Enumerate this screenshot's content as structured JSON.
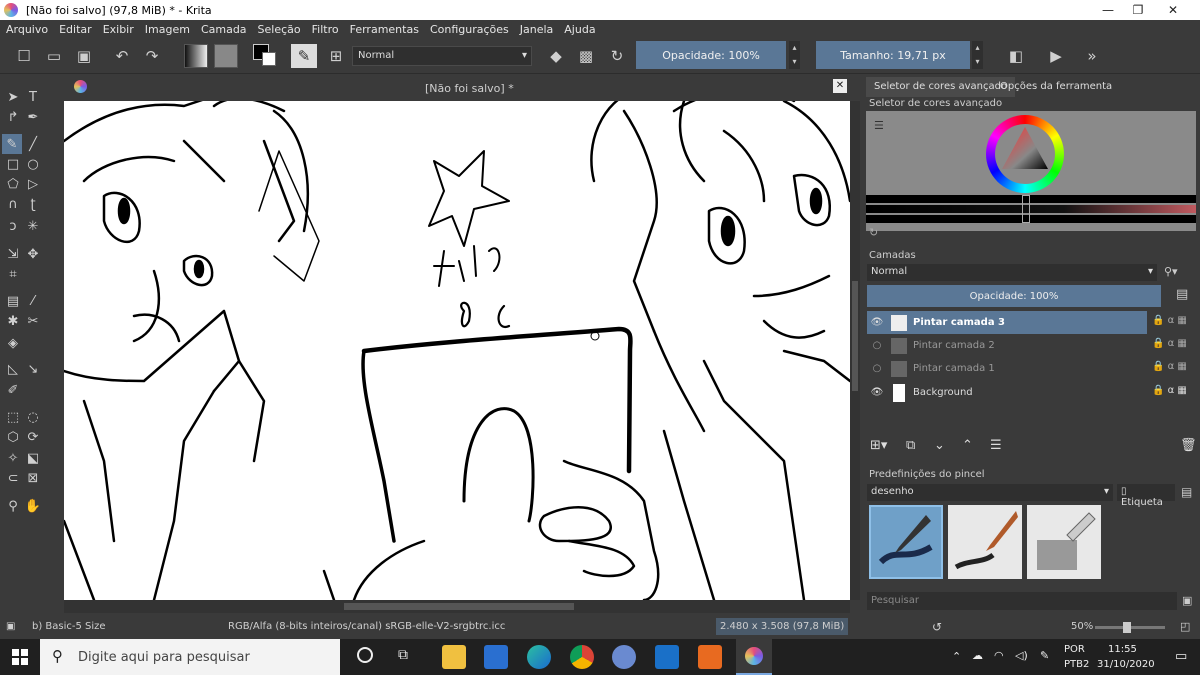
{
  "window": {
    "title": "[Não foi salvo]  (97,8 MiB)  * - Krita",
    "minimize": "—",
    "maximize": "❐",
    "close": "✕"
  },
  "menu": [
    "Arquivo",
    "Editar",
    "Exibir",
    "Imagem",
    "Camada",
    "Seleção",
    "Filtro",
    "Ferramentas",
    "Configurações",
    "Janela",
    "Ajuda"
  ],
  "toolbar": {
    "blend_mode": "Normal",
    "opacity": "Opacidade: 100%",
    "size": "Tamanho: 19,71 px"
  },
  "canvas": {
    "document_tab": "[Não foi salvo]  *",
    "close_tab": "✕"
  },
  "dock": {
    "tab_color": "Seletor de cores avançado",
    "tab_tool": "Opções da ferramenta",
    "color_panel_title": "Seletor de cores avançado",
    "layers_title": "Camadas",
    "layer_blend": "Normal",
    "layer_opacity": "Opacidade:  100%",
    "layers": [
      {
        "name": "Pintar camada 3",
        "active": true,
        "visible": true
      },
      {
        "name": "Pintar camada 2",
        "active": false,
        "visible": false
      },
      {
        "name": "Pintar camada 1",
        "active": false,
        "visible": false
      },
      {
        "name": "Background",
        "active": false,
        "visible": true
      }
    ],
    "presets_title": "Predefinições do pincel",
    "preset_group": "desenho",
    "tag_label": "Etiqueta",
    "search_placeholder": "Pesquisar"
  },
  "status": {
    "brush": "b) Basic-5 Size",
    "color_info": "RGB/Alfa (8-bits inteiros/canal)  sRGB-elle-V2-srgbtrc.icc",
    "dimensions": "2.480 x 3.508 (97,8 MiB)",
    "zoom": "50%"
  },
  "taskbar": {
    "search_placeholder": "Digite aqui para pesquisar",
    "language": "POR",
    "layout": "PTB2",
    "time": "11:55",
    "date": "31/10/2020"
  },
  "colors": {
    "accent": "#5a7796",
    "panel": "#3a3a3a",
    "canvas": "#ffffff"
  }
}
